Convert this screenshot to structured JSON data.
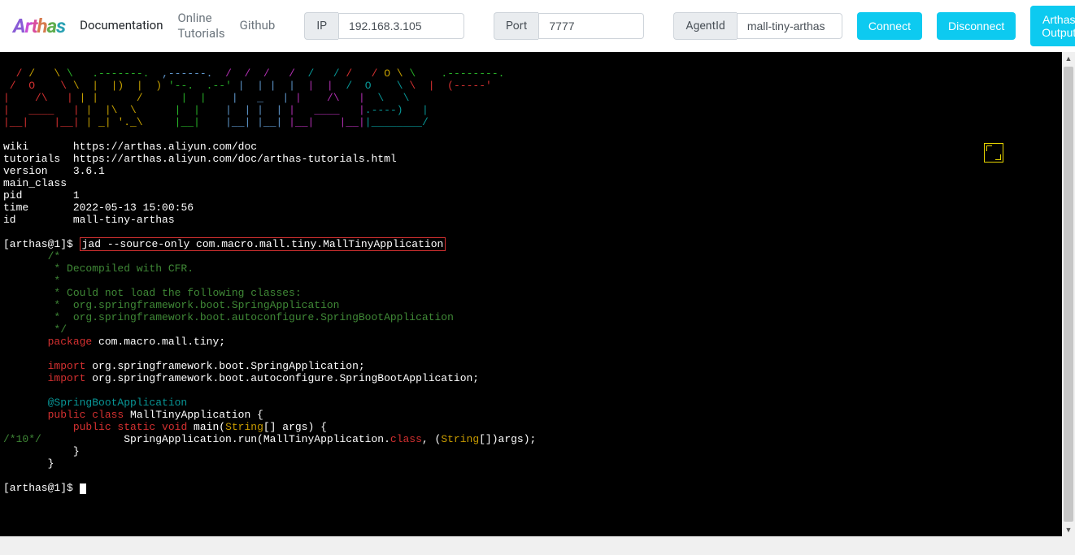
{
  "logo": {
    "letters": [
      "A",
      "r",
      "t",
      "h",
      "a",
      "s"
    ]
  },
  "nav": {
    "documentation": "Documentation",
    "tutorials": "Online\nTutorials",
    "github": "Github"
  },
  "fields": {
    "ip": {
      "label": "IP",
      "value": "192.168.3.105"
    },
    "port": {
      "label": "Port",
      "value": "7777"
    },
    "agentid": {
      "label": "AgentId",
      "value": "mall-tiny-arthas"
    }
  },
  "buttons": {
    "connect": "Connect",
    "disconnect": "Disconnect",
    "output": "Arthas Output"
  },
  "terminal": {
    "ascii_row1": "  / /   \\ \\   .-------.  ,------.  /  /  /   /  /   / /   / /   O \\ \\    .--------.",
    "ascii_row2": " /  O    \\ \\  |  |)  |  ) '--.  .--' |  | |  |  |  |  /  O    \\ \\  |  (-----'",
    "ascii_row3": "|    /\\   | | |      /      |  |    |   _   | |    /\\   |  \\   \\",
    "ascii_row4": "|   ____   | |  |\\  \\      |  |    |  | |  | |   ____   |.----)   |",
    "ascii_row5": "|__|    |__| | _| '._\\     |__|    |__| |__| |__|    |__||________/",
    "info": {
      "wiki_label": "wiki",
      "wiki_url": "https://arthas.aliyun.com/doc",
      "tutorials_label": "tutorials",
      "tutorials_url": "https://arthas.aliyun.com/doc/arthas-tutorials.html",
      "version_label": "version",
      "version_val": "3.6.1",
      "main_class_label": "main_class",
      "pid_label": "pid",
      "pid_val": "1",
      "time_label": "time",
      "time_val": "2022-05-13 15:00:56",
      "id_label": "id",
      "id_val": "mall-tiny-arthas"
    },
    "prompt1": "[arthas@1]$ ",
    "cmd": "jad --source-only com.macro.mall.tiny.MallTinyApplication",
    "comment1": "       /*",
    "comment2": "        * Decompiled with CFR.",
    "comment3": "        *",
    "comment4": "        * Could not load the following classes:",
    "comment5": "        *  org.springframework.boot.SpringApplication",
    "comment6": "        *  org.springframework.boot.autoconfigure.SpringBootApplication",
    "comment7": "        */",
    "pkg_kw": "       package",
    "pkg_rest": " com.macro.mall.tiny;",
    "imp_kw": "       import",
    "imp1": " org.springframework.boot.SpringApplication;",
    "imp2": " org.springframework.boot.autoconfigure.SpringBootApplication;",
    "anno": "       @SpringBootApplication",
    "pub": "       public",
    "cls": " class",
    "cls_rest": " MallTinyApplication {",
    "pub2": "           public",
    "static_kw": " static",
    "void_kw": " void",
    "main_kw": " main(",
    "string1": "String",
    "main_rest": "[] args) {",
    "line10": "/*10*/",
    "run1": "             SpringApplication.run(MallTinyApplication.",
    "class_kw": "class",
    "run2": ", (",
    "string2": "String",
    "run3": "[])args);",
    "close1": "           }",
    "close2": "       }",
    "prompt2": "[arthas@1]$ "
  }
}
